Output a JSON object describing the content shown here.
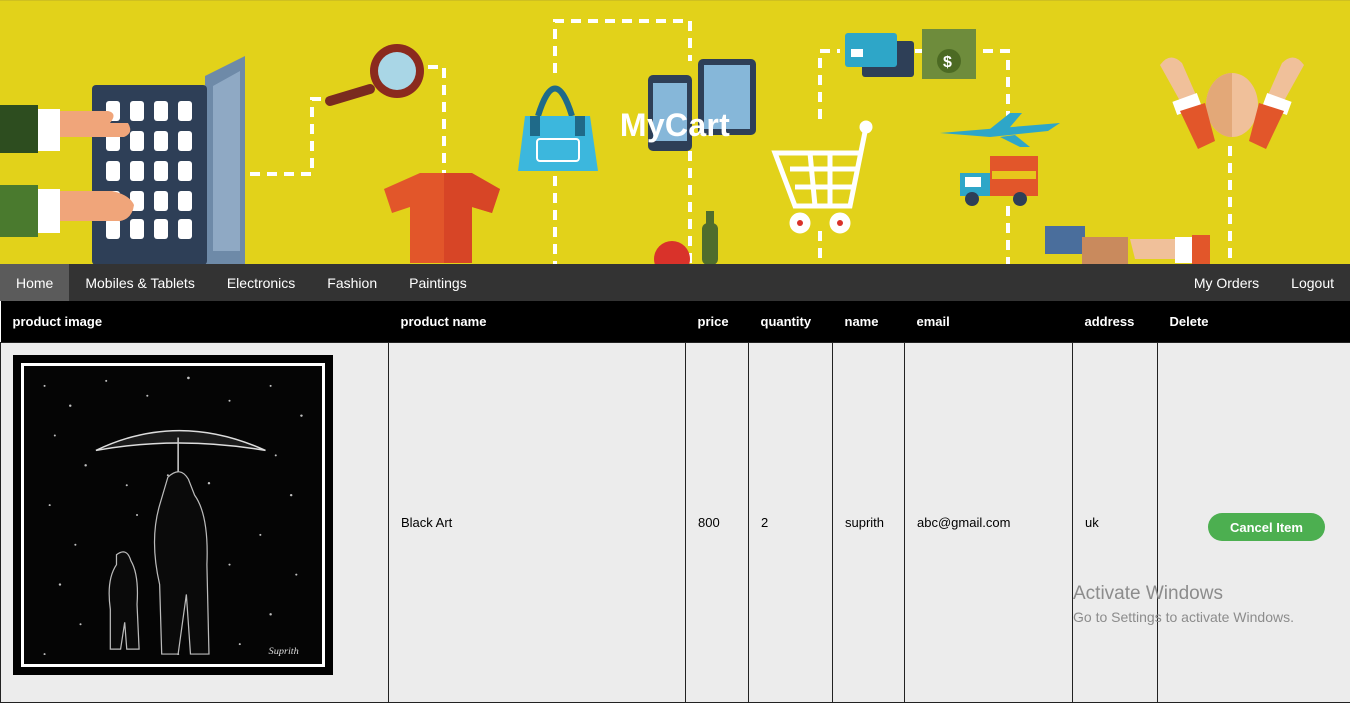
{
  "site": {
    "title": "MyCart"
  },
  "nav": {
    "left": [
      "Home",
      "Mobiles & Tablets",
      "Electronics",
      "Fashion",
      "Paintings"
    ],
    "right": [
      "My Orders",
      "Logout"
    ],
    "active": "Home"
  },
  "table": {
    "headers": [
      "product image",
      "product name",
      "price",
      "quantity",
      "name",
      "email",
      "address",
      "Delete"
    ],
    "rows": [
      {
        "product_name": "Black Art",
        "price": "800",
        "quantity": "2",
        "name": "suprith",
        "email": "abc@gmail.com",
        "address": "uk",
        "action_label": "Cancel Item"
      }
    ]
  },
  "watermark": {
    "title": "Activate Windows",
    "subtitle": "Go to Settings to activate Windows."
  },
  "colors": {
    "banner": "#e2d21a",
    "navbar": "#333333",
    "active_tab": "#5b5b5b",
    "cancel_button": "#4caf50",
    "table_header": "#000000",
    "row_bg": "#ececec"
  }
}
